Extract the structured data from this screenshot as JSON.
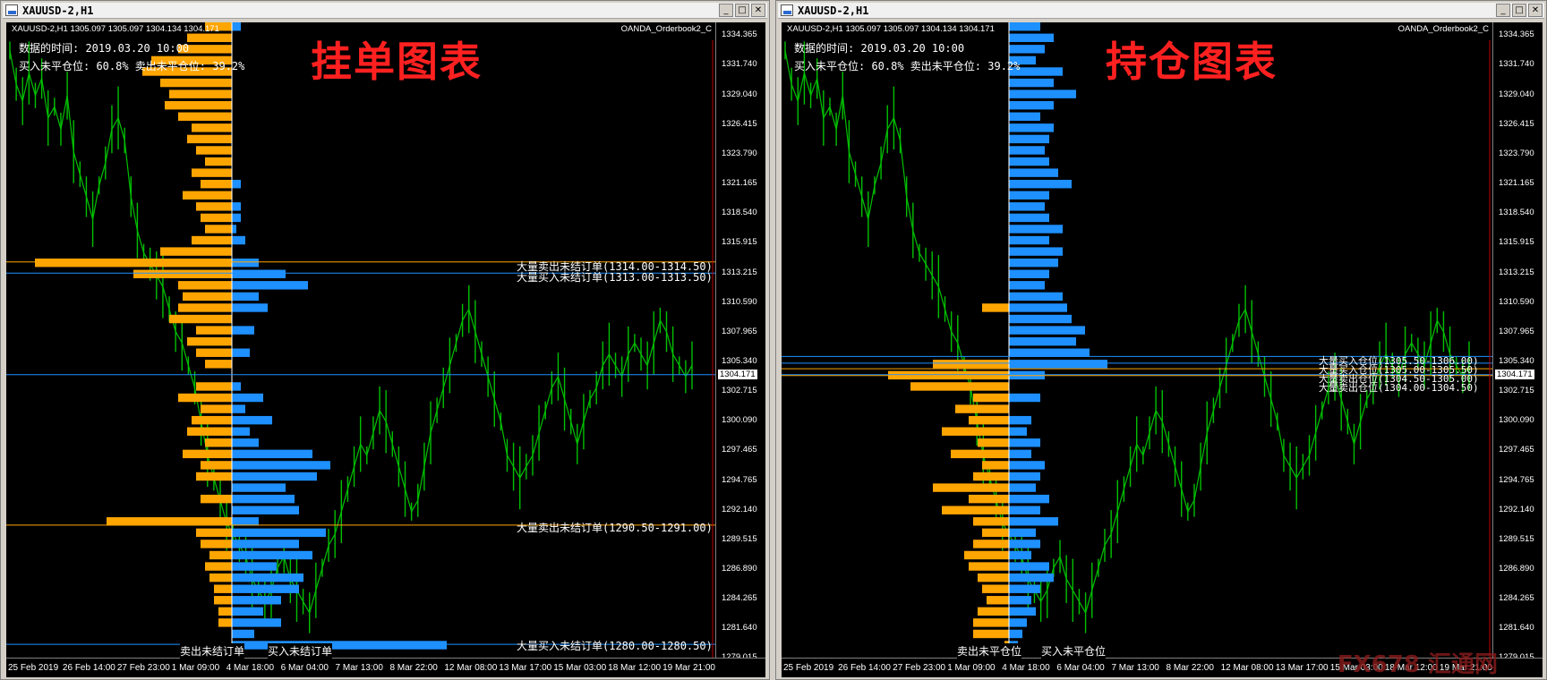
{
  "windows": [
    {
      "id": "left",
      "title": "XAUUSD-2,H1",
      "chart_header": "XAUUSD-2,H1  1305.097 1305.097 1304.134 1304.171",
      "indicator_name": "OANDA_Orderbook2_C",
      "info_time": "数据的时间: 2019.03.20 10:00",
      "info_ratio": "买入未平仓位: 60.8%  卖出未平仓位: 39.2%",
      "big_title": "挂单图表",
      "annotations": [
        "大量卖出未结订单(1314.00-1314.50)",
        "大量买入未结订单(1313.00-1313.50)",
        "大量卖出未结订单(1290.50-1291.00)",
        "大量买入未结订单(1280.00-1280.50)"
      ],
      "footer_left": "卖出未结订单",
      "footer_right": "买入未结订单"
    },
    {
      "id": "right",
      "title": "XAUUSD-2,H1",
      "chart_header": "XAUUSD-2,H1  1305.097 1305.097 1304.134 1304.171",
      "indicator_name": "OANDA_Orderbook2_C",
      "info_time": "数据的时间: 2019.03.20 10:00",
      "info_ratio": "买入未平仓位: 60.8%  卖出未平仓位: 39.2%",
      "big_title": "持仓图表",
      "annotations": [
        "大量买入仓位(1305.50-1306.00)",
        "大量买入仓位(1305.00-1305.50)",
        "大量卖出仓位(1304.50-1305.00)",
        "大量卖出仓位(1304.00-1304.50)"
      ],
      "footer_left": "卖出未平仓位",
      "footer_right": "买入未平仓位"
    }
  ],
  "window_buttons": {
    "minimize": "_",
    "maximize": "□",
    "close": "✕"
  },
  "y_ticks": [
    "1334.365",
    "1331.740",
    "1329.040",
    "1326.415",
    "1323.790",
    "1321.165",
    "1318.540",
    "1315.915",
    "1313.215",
    "1310.590",
    "1307.965",
    "1305.340",
    "1302.715",
    "1300.090",
    "1297.465",
    "1294.765",
    "1292.140",
    "1289.515",
    "1286.890",
    "1284.265",
    "1281.640",
    "1279.015"
  ],
  "current_price": "1304.171",
  "x_ticks": [
    "25 Feb 2019",
    "26 Feb 14:00",
    "27 Feb 23:00",
    "1 Mar 09:00",
    "4 Mar 18:00",
    "6 Mar 04:00",
    "7 Mar 13:00",
    "8 Mar 22:00",
    "12 Mar 08:00",
    "13 Mar 17:00",
    "15 Mar 03:00",
    "18 Mar 12:00",
    "19 Mar 21:00"
  ],
  "watermark": "FX678 汇通网",
  "colors": {
    "sell": "#ffa500",
    "buy": "#1e90ff",
    "price": "#00c000",
    "bg": "#000000",
    "red_title": "#ff2020"
  },
  "chart_data": {
    "type": "bar",
    "y_range": [
      1279.015,
      1335.5
    ],
    "price_series": [
      1333,
      1330,
      1328.5,
      1331,
      1329,
      1330.5,
      1327,
      1328,
      1326,
      1329,
      1324,
      1322,
      1320,
      1318,
      1321,
      1323,
      1326,
      1327,
      1325,
      1320,
      1317,
      1315,
      1314,
      1313,
      1312,
      1310,
      1308,
      1307,
      1305,
      1303,
      1300,
      1297,
      1295,
      1293,
      1291,
      1290,
      1289,
      1288,
      1286,
      1285,
      1284,
      1285,
      1287,
      1288,
      1286,
      1285,
      1284,
      1283,
      1285,
      1287,
      1289,
      1290,
      1292,
      1294,
      1296,
      1298,
      1297,
      1299,
      1301,
      1300,
      1298,
      1296,
      1294,
      1292,
      1293,
      1296,
      1299,
      1301,
      1303,
      1305,
      1307,
      1309,
      1310,
      1308,
      1306,
      1304,
      1302,
      1300,
      1297,
      1296,
      1295,
      1296,
      1297,
      1299,
      1301,
      1303,
      1304,
      1302,
      1300,
      1298,
      1300,
      1302,
      1303,
      1305,
      1306,
      1305,
      1304,
      1306,
      1307,
      1306,
      1305,
      1307,
      1309,
      1308,
      1306,
      1305,
      1304,
      1305
    ],
    "sell_orders": [
      [
        1335,
        0.3
      ],
      [
        1334,
        0.5
      ],
      [
        1333,
        0.6
      ],
      [
        1332,
        0.9
      ],
      [
        1331,
        1.0
      ],
      [
        1330,
        0.8
      ],
      [
        1329,
        0.7
      ],
      [
        1328,
        0.75
      ],
      [
        1327,
        0.6
      ],
      [
        1326,
        0.45
      ],
      [
        1325,
        0.5
      ],
      [
        1324,
        0.4
      ],
      [
        1323,
        0.3
      ],
      [
        1322,
        0.45
      ],
      [
        1321,
        0.35
      ],
      [
        1320,
        0.55
      ],
      [
        1319,
        0.4
      ],
      [
        1318,
        0.35
      ],
      [
        1317,
        0.3
      ],
      [
        1316,
        0.45
      ],
      [
        1315,
        0.8
      ],
      [
        1314,
        2.2
      ],
      [
        1313,
        1.1
      ],
      [
        1312,
        0.6
      ],
      [
        1311,
        0.55
      ],
      [
        1310,
        0.6
      ],
      [
        1309,
        0.7
      ],
      [
        1308,
        0.4
      ],
      [
        1307,
        0.5
      ],
      [
        1306,
        0.4
      ],
      [
        1305,
        0.3
      ],
      [
        1303,
        0.4
      ],
      [
        1302,
        0.6
      ],
      [
        1301,
        0.35
      ],
      [
        1300,
        0.45
      ],
      [
        1299,
        0.5
      ],
      [
        1298,
        0.3
      ],
      [
        1297,
        0.55
      ],
      [
        1296,
        0.35
      ],
      [
        1295,
        0.4
      ],
      [
        1293,
        0.35
      ],
      [
        1291,
        1.4
      ],
      [
        1290,
        0.4
      ],
      [
        1289,
        0.35
      ],
      [
        1288,
        0.25
      ],
      [
        1287,
        0.3
      ],
      [
        1286,
        0.25
      ],
      [
        1285,
        0.2
      ],
      [
        1284,
        0.2
      ],
      [
        1283,
        0.15
      ],
      [
        1282,
        0.15
      ]
    ],
    "buy_orders": [
      [
        1335,
        0.1
      ],
      [
        1321,
        0.1
      ],
      [
        1319,
        0.1
      ],
      [
        1318,
        0.1
      ],
      [
        1317,
        0.05
      ],
      [
        1316,
        0.15
      ],
      [
        1314,
        0.3
      ],
      [
        1313,
        0.6
      ],
      [
        1312,
        0.85
      ],
      [
        1311,
        0.3
      ],
      [
        1310,
        0.4
      ],
      [
        1308,
        0.25
      ],
      [
        1306,
        0.2
      ],
      [
        1303,
        0.1
      ],
      [
        1302,
        0.35
      ],
      [
        1301,
        0.15
      ],
      [
        1300,
        0.45
      ],
      [
        1299,
        0.2
      ],
      [
        1298,
        0.3
      ],
      [
        1297,
        0.9
      ],
      [
        1296,
        1.1
      ],
      [
        1295,
        0.95
      ],
      [
        1294,
        0.6
      ],
      [
        1293,
        0.7
      ],
      [
        1292,
        0.75
      ],
      [
        1291,
        0.3
      ],
      [
        1290,
        1.05
      ],
      [
        1289,
        0.75
      ],
      [
        1288,
        0.9
      ],
      [
        1287,
        0.5
      ],
      [
        1286,
        0.8
      ],
      [
        1285,
        0.75
      ],
      [
        1284,
        0.55
      ],
      [
        1283,
        0.35
      ],
      [
        1282,
        0.55
      ],
      [
        1281,
        0.25
      ],
      [
        1280,
        2.4
      ]
    ],
    "sell_positions": [
      [
        1310,
        0.3
      ],
      [
        1305,
        0.85
      ],
      [
        1304,
        1.35
      ],
      [
        1303,
        1.1
      ],
      [
        1302,
        0.4
      ],
      [
        1301,
        0.6
      ],
      [
        1300,
        0.45
      ],
      [
        1299,
        0.75
      ],
      [
        1298,
        0.35
      ],
      [
        1297,
        0.65
      ],
      [
        1296,
        0.3
      ],
      [
        1295,
        0.4
      ],
      [
        1294,
        0.85
      ],
      [
        1293,
        0.45
      ],
      [
        1292,
        0.75
      ],
      [
        1291,
        0.4
      ],
      [
        1290,
        0.3
      ],
      [
        1289,
        0.4
      ],
      [
        1288,
        0.5
      ],
      [
        1287,
        0.45
      ],
      [
        1286,
        0.35
      ],
      [
        1285,
        0.3
      ],
      [
        1284,
        0.25
      ],
      [
        1283,
        0.35
      ],
      [
        1282,
        0.4
      ],
      [
        1281,
        0.4
      ],
      [
        1280,
        0.05
      ]
    ],
    "buy_positions": [
      [
        1335,
        0.35
      ],
      [
        1334,
        0.5
      ],
      [
        1333,
        0.4
      ],
      [
        1332,
        0.3
      ],
      [
        1331,
        0.6
      ],
      [
        1330,
        0.5
      ],
      [
        1329,
        0.75
      ],
      [
        1328,
        0.5
      ],
      [
        1327,
        0.35
      ],
      [
        1326,
        0.5
      ],
      [
        1325,
        0.45
      ],
      [
        1324,
        0.4
      ],
      [
        1323,
        0.45
      ],
      [
        1322,
        0.55
      ],
      [
        1321,
        0.7
      ],
      [
        1320,
        0.45
      ],
      [
        1319,
        0.4
      ],
      [
        1318,
        0.45
      ],
      [
        1317,
        0.6
      ],
      [
        1316,
        0.45
      ],
      [
        1315,
        0.6
      ],
      [
        1314,
        0.55
      ],
      [
        1313,
        0.45
      ],
      [
        1312,
        0.4
      ],
      [
        1311,
        0.6
      ],
      [
        1310,
        0.65
      ],
      [
        1309,
        0.7
      ],
      [
        1308,
        0.85
      ],
      [
        1307,
        0.75
      ],
      [
        1306,
        0.9
      ],
      [
        1305,
        1.1
      ],
      [
        1304,
        0.4
      ],
      [
        1302,
        0.35
      ],
      [
        1300,
        0.25
      ],
      [
        1299,
        0.2
      ],
      [
        1298,
        0.35
      ],
      [
        1297,
        0.25
      ],
      [
        1296,
        0.4
      ],
      [
        1295,
        0.35
      ],
      [
        1294,
        0.3
      ],
      [
        1293,
        0.45
      ],
      [
        1292,
        0.35
      ],
      [
        1291,
        0.55
      ],
      [
        1290,
        0.3
      ],
      [
        1289,
        0.35
      ],
      [
        1288,
        0.25
      ],
      [
        1287,
        0.45
      ],
      [
        1286,
        0.5
      ],
      [
        1285,
        0.35
      ],
      [
        1284,
        0.25
      ],
      [
        1283,
        0.3
      ],
      [
        1282,
        0.2
      ],
      [
        1281,
        0.15
      ],
      [
        1280,
        0.1
      ]
    ],
    "left_lines": [
      {
        "price": 1314.2,
        "color": "#ffa500"
      },
      {
        "price": 1313.2,
        "color": "#1e90ff"
      },
      {
        "price": 1304.171,
        "color": "#1e90ff"
      },
      {
        "price": 1290.8,
        "color": "#ffa500"
      },
      {
        "price": 1280.2,
        "color": "#1e90ff"
      }
    ],
    "right_lines": [
      {
        "price": 1305.8,
        "color": "#1e90ff"
      },
      {
        "price": 1305.2,
        "color": "#1e90ff"
      },
      {
        "price": 1304.7,
        "color": "#ffa500"
      },
      {
        "price": 1304.171,
        "color": "#1e90ff"
      },
      {
        "price": 1304.1,
        "color": "#ffa500"
      }
    ]
  }
}
